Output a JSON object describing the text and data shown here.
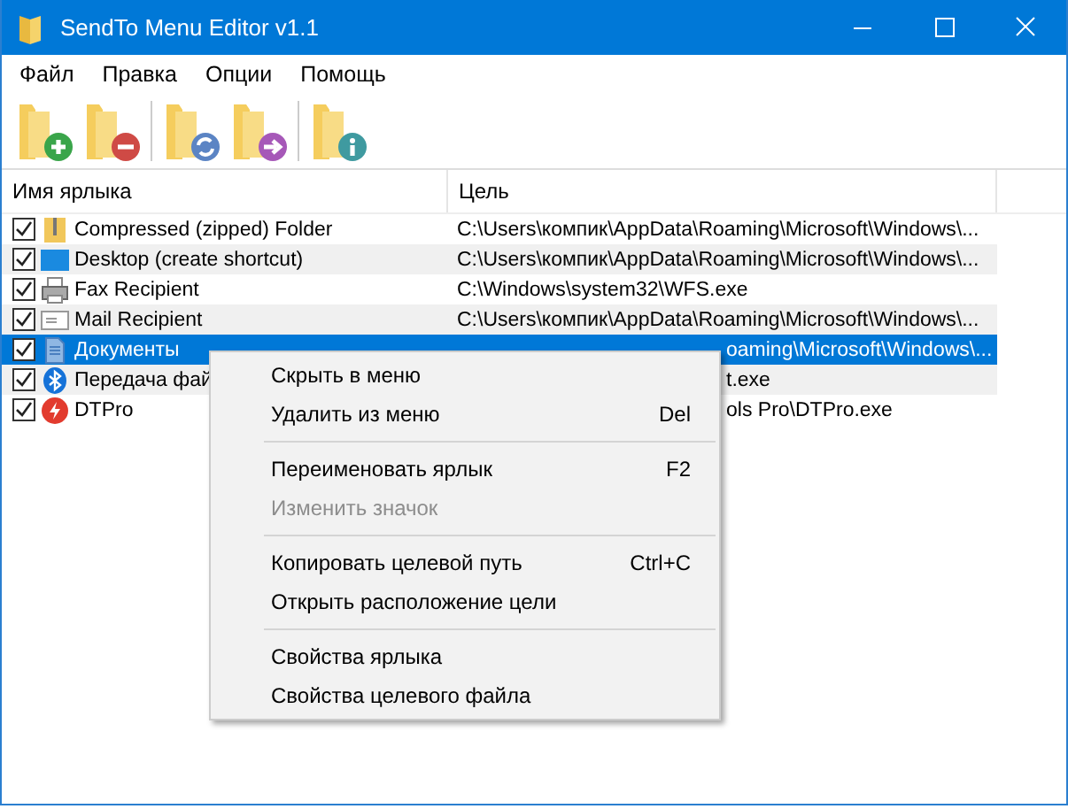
{
  "window": {
    "title": "SendTo Menu Editor v1.1"
  },
  "menu": [
    "Файл",
    "Правка",
    "Опции",
    "Помощь"
  ],
  "toolbar": [
    {
      "kind": "add"
    },
    {
      "kind": "remove"
    },
    {
      "kind": "refresh"
    },
    {
      "kind": "send"
    },
    {
      "kind": "info"
    }
  ],
  "table": {
    "columns": [
      "Имя ярлыка",
      "Цель"
    ],
    "rows": [
      {
        "checked": true,
        "selected": false,
        "name": "Compressed (zipped) Folder",
        "target": "C:\\Users\\компик\\AppData\\Roaming\\Microsoft\\Windows\\..."
      },
      {
        "checked": true,
        "selected": false,
        "name": "Desktop (create shortcut)",
        "target": "C:\\Users\\компик\\AppData\\Roaming\\Microsoft\\Windows\\..."
      },
      {
        "checked": true,
        "selected": false,
        "name": "Fax Recipient",
        "target": "C:\\Windows\\system32\\WFS.exe"
      },
      {
        "checked": true,
        "selected": false,
        "name": "Mail Recipient",
        "target": "C:\\Users\\компик\\AppData\\Roaming\\Microsoft\\Windows\\..."
      },
      {
        "checked": true,
        "selected": true,
        "name": "Документы",
        "target": "oaming\\Microsoft\\Windows\\...",
        "kind": "partly_hidden"
      },
      {
        "checked": true,
        "selected": false,
        "name": "Передача фай",
        "target": "t.exe",
        "kind": "partly_hidden"
      },
      {
        "checked": true,
        "selected": false,
        "name": "DTPro",
        "target": "ols Pro\\DTPro.exe",
        "kind": "partly_hidden"
      }
    ]
  },
  "context_menu": [
    {
      "label": "Скрыть в меню",
      "disabled": false
    },
    {
      "label": "Удалить из меню",
      "shortcut": "Del",
      "disabled": false
    },
    {
      "kind": "separator"
    },
    {
      "label": "Переименовать ярлык",
      "shortcut": "F2",
      "disabled": false
    },
    {
      "label": "Изменить значок",
      "disabled": true
    },
    {
      "kind": "separator"
    },
    {
      "label": "Копировать целевой путь",
      "shortcut": "Ctrl+C",
      "disabled": false
    },
    {
      "label": "Открыть расположение цели",
      "disabled": false
    },
    {
      "kind": "separator"
    },
    {
      "label": "Свойства ярлыка",
      "disabled": false
    },
    {
      "label": "Свойства целевого файла",
      "disabled": false
    }
  ]
}
